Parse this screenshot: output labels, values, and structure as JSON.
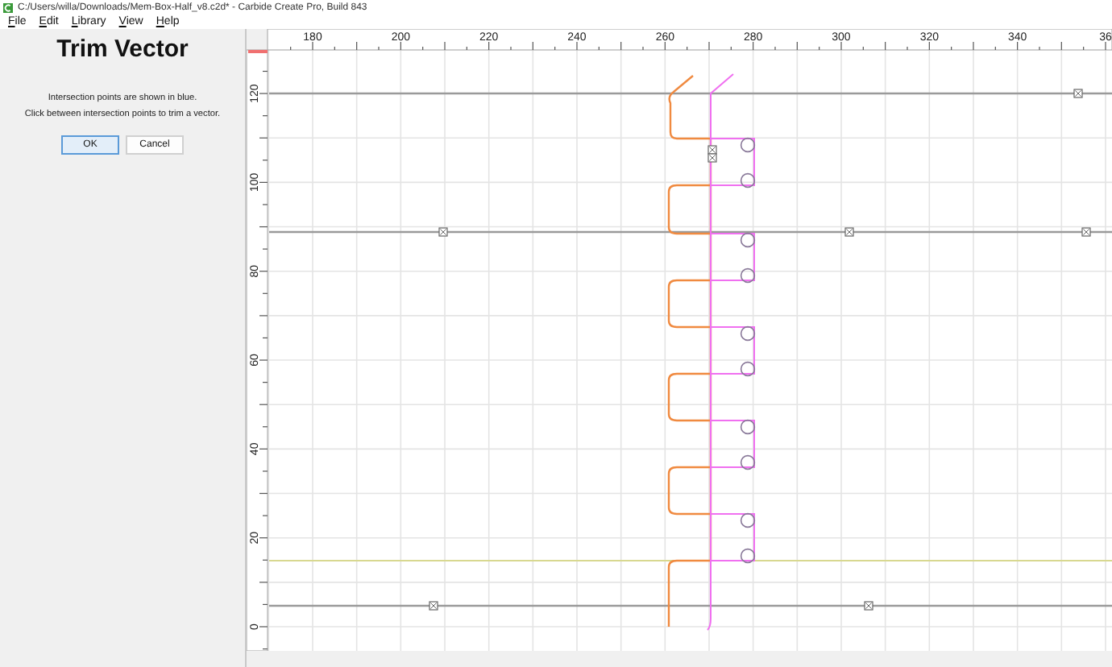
{
  "window": {
    "title": "C:/Users/willa/Downloads/Mem-Box-Half_v8.c2d* - Carbide Create Pro, Build 843"
  },
  "menu": [
    "File",
    "Edit",
    "Library",
    "View",
    "Help"
  ],
  "panel": {
    "title": "Trim Vector",
    "instructions": [
      "Intersection points are shown in blue.",
      "Click between intersection points to trim a vector."
    ],
    "buttons": [
      {
        "label": "OK",
        "selected": true
      },
      {
        "label": "Cancel",
        "selected": false
      }
    ]
  },
  "ruler": {
    "x_labels": [
      "180",
      "200",
      "220",
      "240",
      "260",
      "280",
      "300",
      "320",
      "340",
      "36"
    ],
    "y_labels": [
      "0",
      "20",
      "40",
      "60",
      "80",
      "100",
      "120"
    ]
  }
}
